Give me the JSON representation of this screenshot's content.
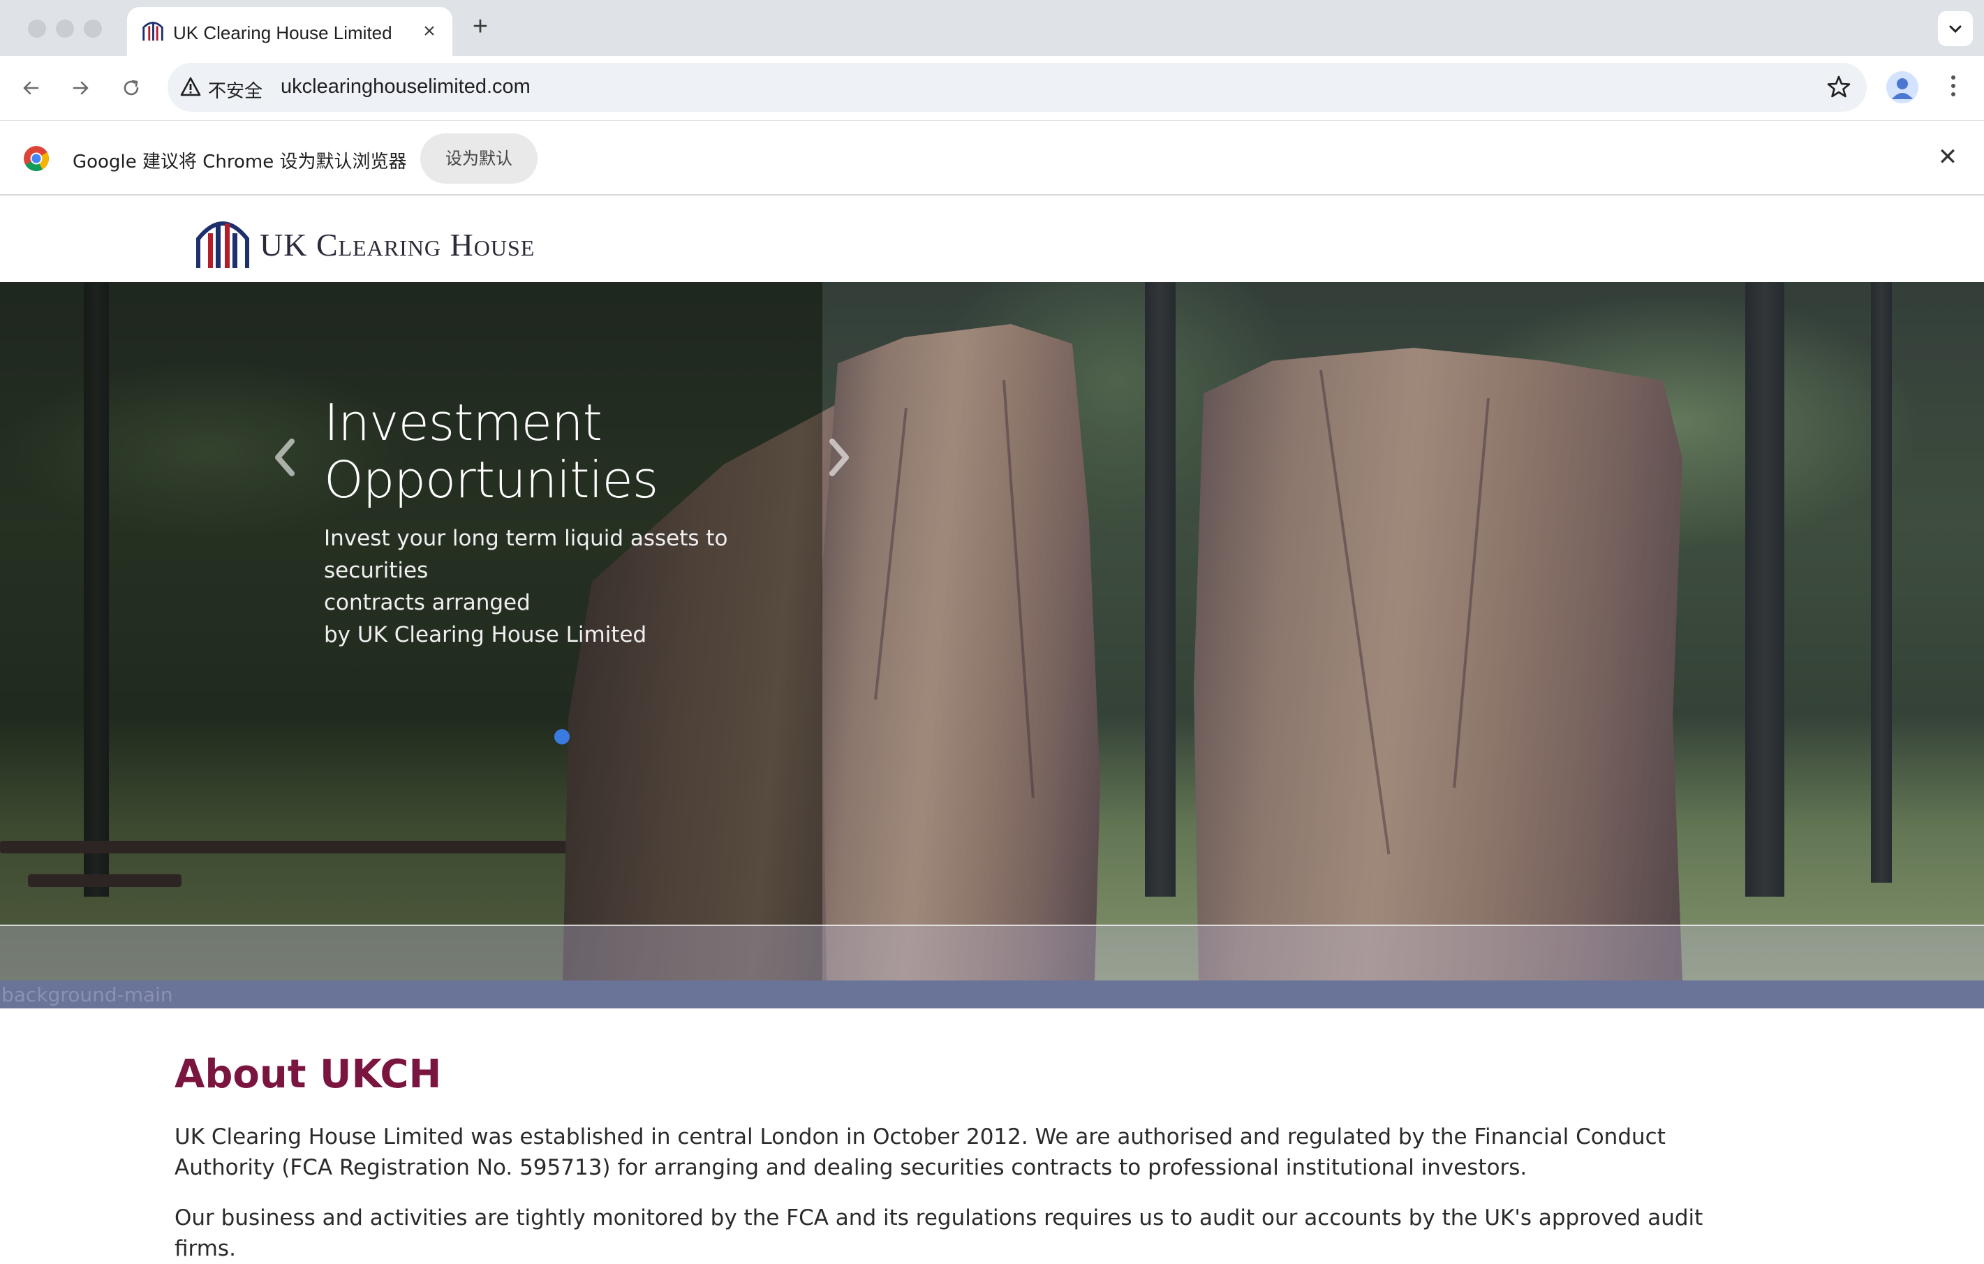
{
  "browser": {
    "tab_title": "UK Clearing House Limited",
    "new_tab_icon": "plus-icon",
    "security_label": "不安全",
    "url": "ukclearinghouselimited.com",
    "infobar_text": "Google 建议将 Chrome 设为默认浏览器",
    "infobar_button": "设为默认"
  },
  "site": {
    "logo_text": "UK Clearing House",
    "brand_colors": {
      "logo_blue": "#1e2f6e",
      "logo_red": "#b51c2a",
      "heading": "#7a1540"
    },
    "hero": {
      "title": "Investment Opportunities",
      "subtitle_lines": [
        "Invest your long term liquid assets to securities",
        "contracts arranged",
        "by UK Clearing House Limited"
      ],
      "active_slide": 1
    },
    "background_label": "background-main",
    "about": {
      "title": "About UKCH",
      "paragraph1": "UK Clearing House Limited was established in central London in October 2012. We are authorised and regulated by the Financial Conduct Authority (FCA Registration No. 595713) for arranging and dealing securities contracts to professional institutional investors.",
      "paragraph2": "Our business and activities are tightly monitored by the FCA and its regulations requires us to audit our accounts by the UK's approved audit firms."
    }
  }
}
